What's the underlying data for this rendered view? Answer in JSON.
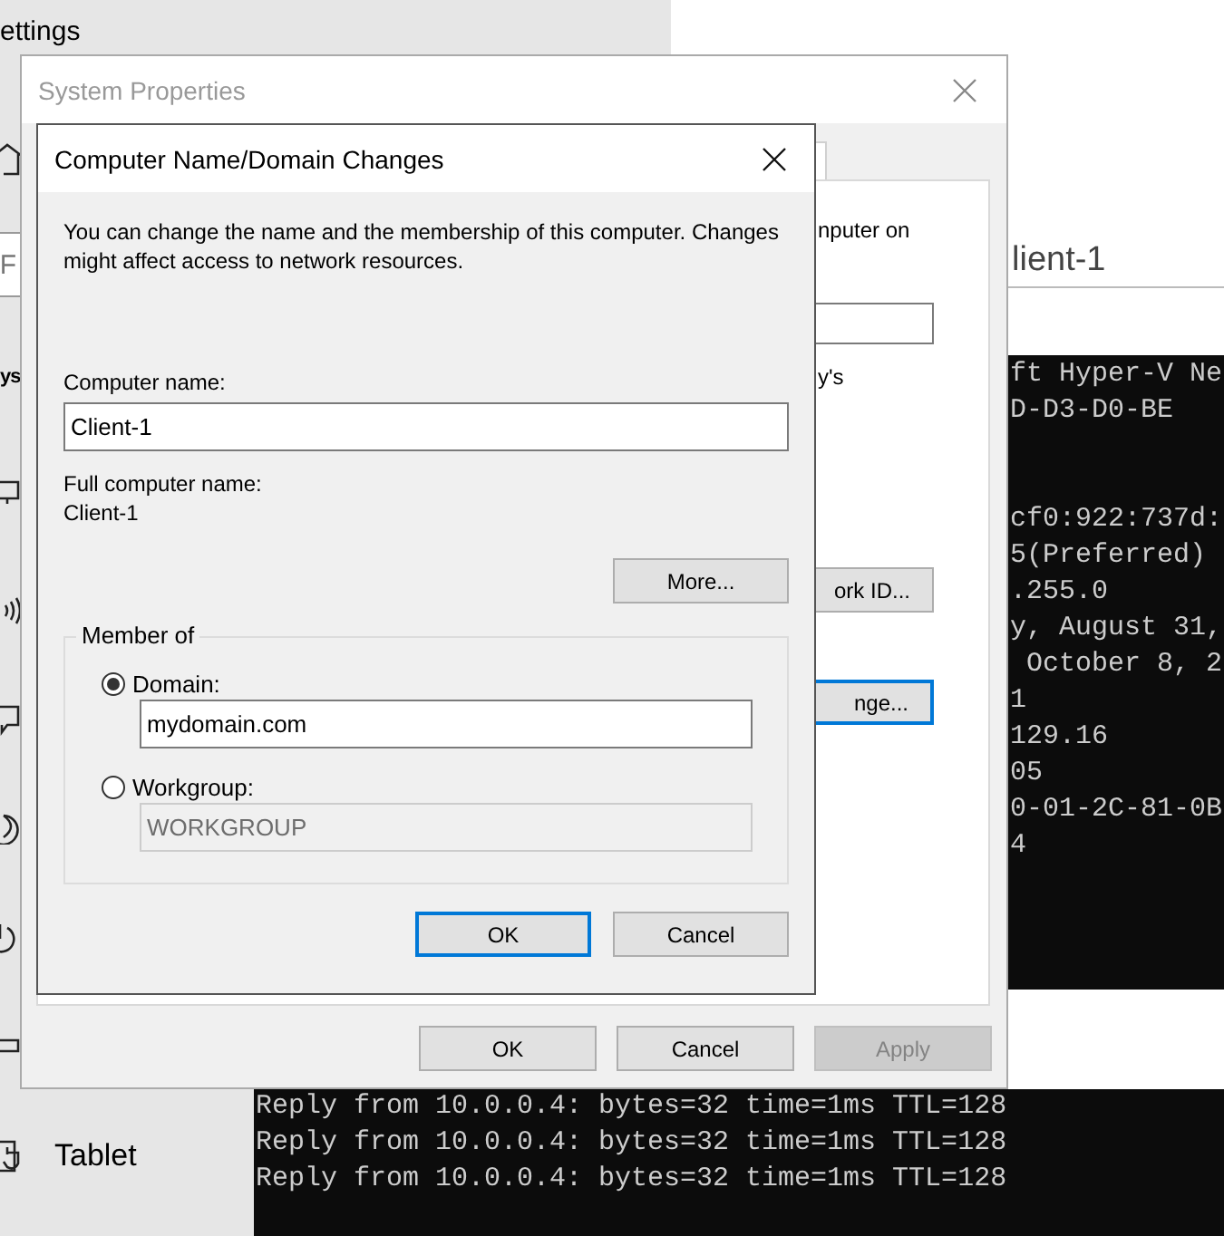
{
  "settings_window": {
    "title": "ettings",
    "search_field": {
      "placeholder": "F"
    },
    "heading": "ys",
    "nav_items": [
      {
        "label": "Tablet"
      }
    ]
  },
  "background_text": "lient-1",
  "console": {
    "right_blocks": [
      [
        "ft Hyper-V Ne",
        "D-D3-D0-BE"
      ],
      [
        "cf0:922:737d:",
        "5(Preferred)",
        ".255.0",
        "y, August 31,",
        " October 8, 2",
        "1",
        "129.16",
        "05",
        "0-01-2C-81-0B",
        "4"
      ]
    ],
    "bottom_lines": [
      "Reply from 10.0.0.4: bytes=32 time=1ms TTL=128",
      "Reply from 10.0.0.4: bytes=32 time=1ms TTL=128",
      "Reply from 10.0.0.4: bytes=32 time=1ms TTL=128"
    ]
  },
  "system_properties": {
    "title": "System Properties",
    "panel_texts": [
      "nputer on",
      "y's"
    ],
    "panel_buttons": [
      {
        "label": "ork ID...",
        "default": false
      },
      {
        "label": "nge...",
        "default": true
      }
    ],
    "buttons": [
      {
        "label": "OK",
        "disabled": false
      },
      {
        "label": "Cancel",
        "disabled": false
      },
      {
        "label": "Apply",
        "disabled": true
      }
    ]
  },
  "dialog": {
    "title": "Computer Name/Domain Changes",
    "description": "You can change the name and the membership of this computer. Changes might affect access to network resources.",
    "computer_name_label": "Computer name:",
    "computer_name": "Client-1",
    "full_name_label": "Full computer name:",
    "full_name": "Client-1",
    "more_button": "More...",
    "member_of": {
      "label": "Member of",
      "options": [
        {
          "label": "Domain:",
          "selected": true,
          "value": "mydomain.com"
        },
        {
          "label": "Workgroup:",
          "selected": false,
          "value": "WORKGROUP"
        }
      ]
    },
    "buttons": [
      {
        "label": "OK",
        "default": true
      },
      {
        "label": "Cancel",
        "default": false
      }
    ]
  }
}
